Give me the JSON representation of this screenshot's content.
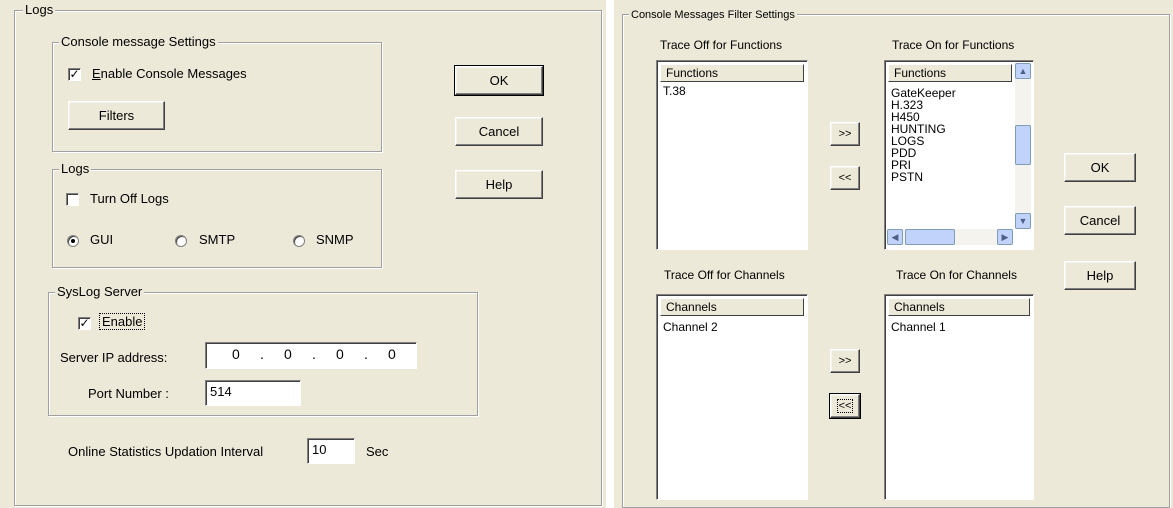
{
  "left": {
    "logs_title": "Logs",
    "console_group": {
      "title": "Console message Settings",
      "enable_label": "Enable Console Messages",
      "enable_checked": true,
      "filters_button": "Filters"
    },
    "logs_group": {
      "title": "Logs",
      "turn_off_label": "Turn Off Logs",
      "turn_off_checked": false,
      "radios": [
        {
          "label": "GUI",
          "selected": true
        },
        {
          "label": "SMTP",
          "selected": false
        },
        {
          "label": "SNMP",
          "selected": false
        }
      ]
    },
    "syslog_group": {
      "title": "SysLog Server",
      "enable_label": "Enable",
      "enable_checked": true,
      "ip_label": "Server IP address:",
      "ip_octets": [
        "0",
        "0",
        "0",
        "0"
      ],
      "port_label": "Port Number :",
      "port_value": "514"
    },
    "interval_label": "Online Statistics Updation Interval",
    "interval_value": "10",
    "interval_unit": "Sec",
    "buttons": {
      "ok": "OK",
      "cancel": "Cancel",
      "help": "Help"
    }
  },
  "right": {
    "title": "Console Messages Filter Settings",
    "functions_off": {
      "caption": "Trace Off for Functions",
      "header": "Functions",
      "items": [
        "T.38"
      ]
    },
    "functions_on": {
      "caption": "Trace On for Functions",
      "header": "Functions",
      "items": [
        "GateKeeper",
        "H.323",
        "H450",
        "HUNTING",
        "LOGS",
        "PDD",
        "PRI",
        "PSTN"
      ]
    },
    "channels_off": {
      "caption": "Trace Off for Channels",
      "header": "Channels",
      "items": [
        "Channel 2"
      ]
    },
    "channels_on": {
      "caption": "Trace On for Channels",
      "header": "Channels",
      "items": [
        "Channel 1"
      ]
    },
    "move_right": ">>",
    "move_left": "<<",
    "buttons": {
      "ok": "OK",
      "cancel": "Cancel",
      "help": "Help"
    }
  }
}
